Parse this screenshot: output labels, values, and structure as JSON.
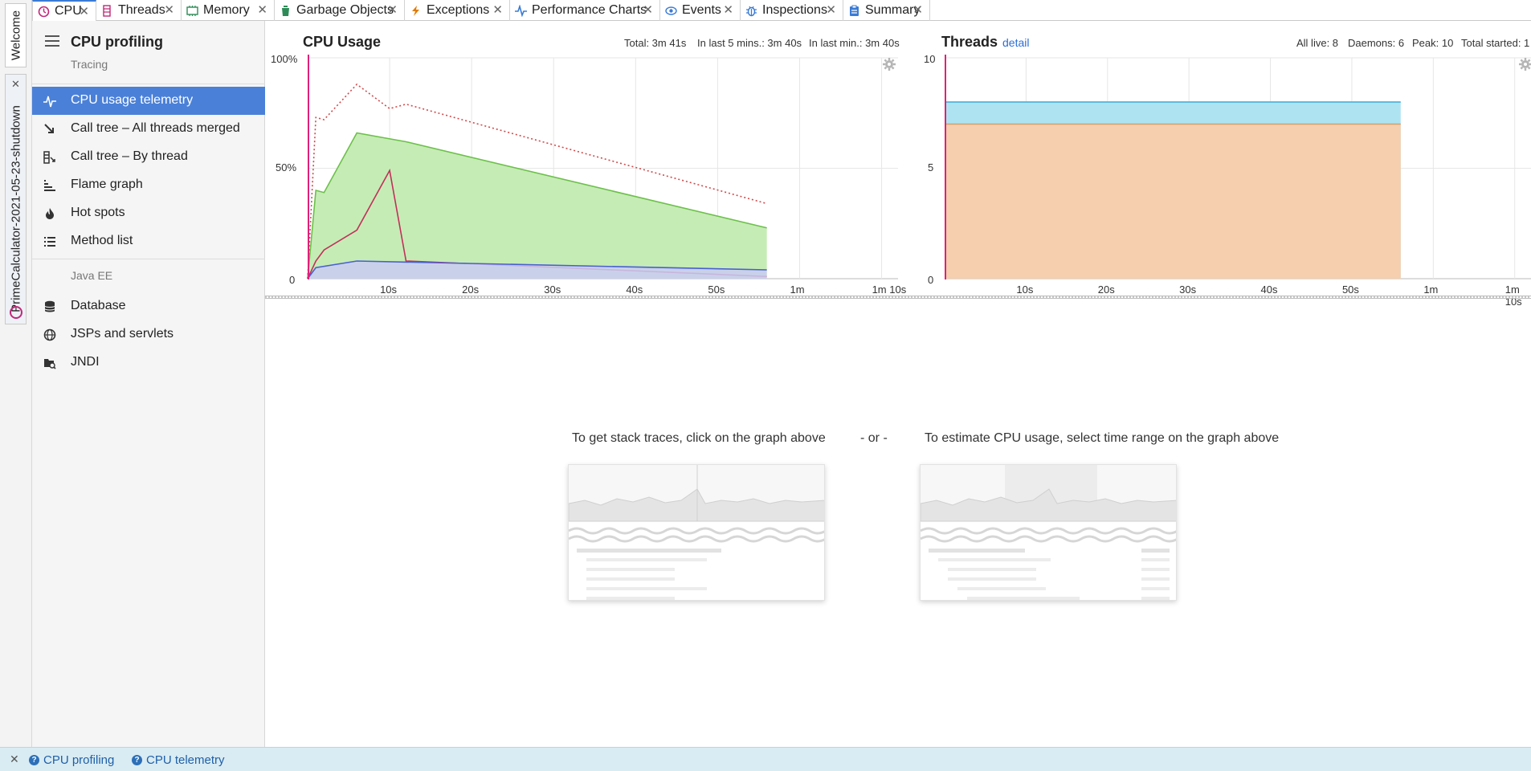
{
  "vertical_tabs": {
    "welcome": "Welcome",
    "session": "PrimeCalculator-2021-05-23-shutdown"
  },
  "tabs": [
    {
      "label": "CPU",
      "icon": "cpu-icon",
      "active": true
    },
    {
      "label": "Threads",
      "icon": "threads-icon",
      "active": false
    },
    {
      "label": "Memory",
      "icon": "memory-icon",
      "active": false
    },
    {
      "label": "Garbage Objects",
      "icon": "garbage-icon",
      "active": false
    },
    {
      "label": "Exceptions",
      "icon": "exception-icon",
      "active": false
    },
    {
      "label": "Performance Charts",
      "icon": "chart-icon",
      "active": false
    },
    {
      "label": "Events",
      "icon": "eye-icon",
      "active": false
    },
    {
      "label": "Inspections",
      "icon": "bug-icon",
      "active": false
    },
    {
      "label": "Summary",
      "icon": "clipboard-icon",
      "active": false
    }
  ],
  "sidebar": {
    "title": "CPU profiling",
    "subtitle": "Tracing",
    "items": [
      {
        "label": "CPU usage telemetry",
        "icon": "telemetry-icon",
        "active": true
      },
      {
        "label": "Call tree – All threads merged",
        "icon": "call-tree-icon"
      },
      {
        "label": "Call tree – By thread",
        "icon": "thread-tree-icon"
      },
      {
        "label": "Flame graph",
        "icon": "flame-graph-icon"
      },
      {
        "label": "Hot spots",
        "icon": "fire-icon"
      },
      {
        "label": "Method list",
        "icon": "list-icon"
      }
    ],
    "section2": "Java EE",
    "items2": [
      {
        "label": "Database",
        "icon": "database-icon"
      },
      {
        "label": "JSPs and servlets",
        "icon": "globe-icon"
      },
      {
        "label": "JNDI",
        "icon": "folder-search-icon"
      }
    ]
  },
  "cpu_chart": {
    "title": "CPU Usage",
    "stats": [
      "Total: 3m 41s",
      "In last 5 mins.: 3m 40s",
      "In last min.: 3m 40s"
    ],
    "y_ticks": [
      "100%",
      "50%",
      "0"
    ],
    "x_ticks": [
      "10s",
      "20s",
      "30s",
      "40s",
      "50s",
      "1m",
      "1m 10s"
    ]
  },
  "threads_chart": {
    "title": "Threads",
    "detail_link": "detail",
    "stats": [
      "All live: 8",
      "Daemons: 6",
      "Peak: 10",
      "Total started: 1"
    ],
    "y_ticks": [
      "10",
      "5",
      "0"
    ],
    "x_ticks": [
      "10s",
      "20s",
      "30s",
      "40s",
      "50s",
      "1m",
      "1m 10s"
    ]
  },
  "chart_data": [
    {
      "type": "area",
      "title": "CPU Usage",
      "xlabel": "",
      "ylabel": "",
      "ylim": [
        0,
        100
      ],
      "xlim": [
        0,
        72
      ],
      "series": [
        {
          "color": "#6cc04a",
          "style": "filled",
          "x": [
            0,
            1,
            2,
            6,
            12,
            56
          ],
          "y": [
            0,
            40,
            39,
            66,
            62,
            23
          ]
        },
        {
          "color": "#d04a4a",
          "style": "dotted",
          "x": [
            0,
            1,
            2,
            6,
            10,
            12,
            56
          ],
          "y": [
            0,
            73,
            72,
            88,
            77,
            79,
            34
          ]
        },
        {
          "color": "#c0305a",
          "style": "line",
          "x": [
            0,
            1,
            2,
            6,
            10,
            12,
            56
          ],
          "y": [
            0,
            8,
            13,
            22,
            49,
            8,
            1
          ]
        },
        {
          "color": "#4a5fd0",
          "style": "filled",
          "x": [
            0,
            1,
            6,
            56
          ],
          "y": [
            0,
            5,
            8,
            4
          ]
        }
      ]
    },
    {
      "type": "area",
      "title": "Threads",
      "xlabel": "",
      "ylabel": "",
      "ylim": [
        0,
        10
      ],
      "xlim": [
        0,
        72
      ],
      "series": [
        {
          "color": "#f5cfae",
          "style": "stacked",
          "x": [
            0,
            56
          ],
          "y": [
            7,
            7
          ]
        },
        {
          "color": "#aee3f2",
          "style": "stacked",
          "x": [
            0,
            56
          ],
          "y": [
            8,
            8
          ]
        }
      ]
    }
  ],
  "hints": {
    "left": "To get stack traces, click on the graph above",
    "or": "- or -",
    "right": "To estimate CPU usage, select time range on the graph above"
  },
  "bottom_links": [
    "CPU profiling",
    "CPU telemetry"
  ],
  "colors": {
    "accent": "#4a80d8",
    "marker": "#e0207a"
  }
}
